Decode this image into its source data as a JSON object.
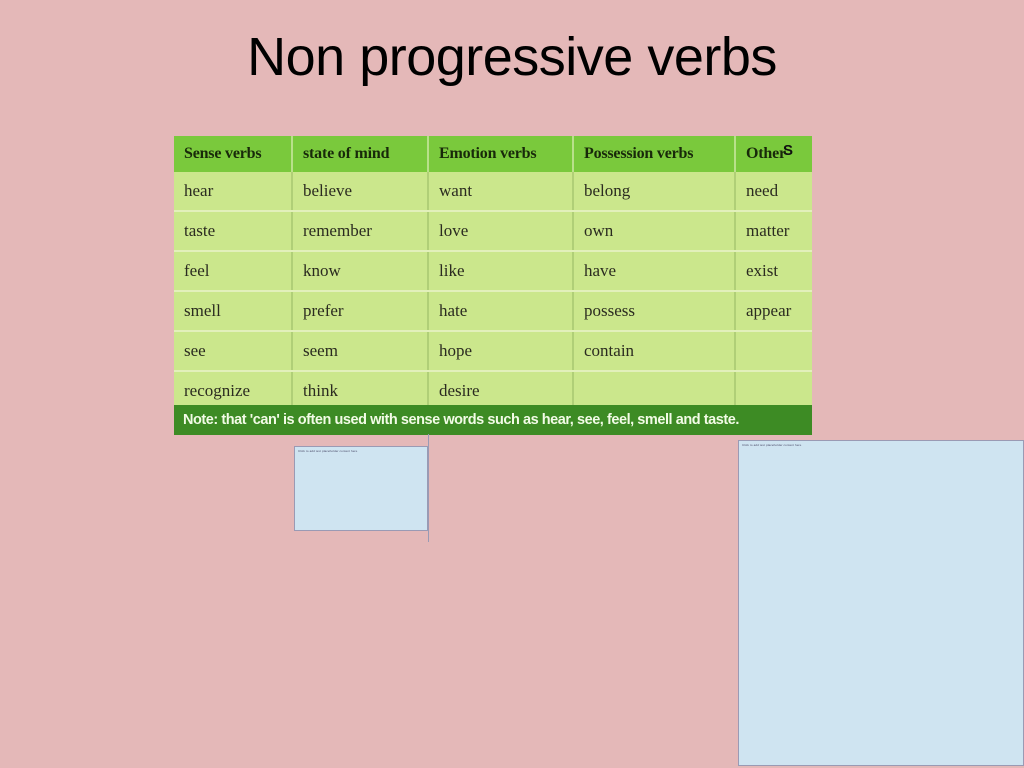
{
  "slide": {
    "title": "Non progressive verbs",
    "background_color": "#e4b8b8"
  },
  "table": {
    "header_color": "#7ac93c",
    "cell_color": "#cbe78c",
    "note_bar_color": "#3d8b24",
    "columns": [
      "Sense verbs",
      "state of mind",
      "Emotion verbs",
      "Possession verbs",
      "Other"
    ],
    "rows": [
      [
        "hear",
        "believe",
        "want",
        "belong",
        "need"
      ],
      [
        "taste",
        "remember",
        "love",
        "own",
        "matter"
      ],
      [
        "feel",
        "know",
        "like",
        "have",
        "exist"
      ],
      [
        "smell",
        "prefer",
        "hate",
        "possess",
        "appear"
      ],
      [
        "see",
        "seem",
        "hope",
        "contain",
        ""
      ],
      [
        "recognize",
        "think",
        "desire",
        "",
        ""
      ]
    ],
    "note": "Note: that 'can' is often used with sense words such as hear, see, feel, smell and taste."
  },
  "overlay": {
    "stray_letter": "S"
  },
  "placeholders": {
    "small": {
      "text": "Click to add text placeholder content here",
      "fill_color": "#cfe4f1"
    },
    "large": {
      "text": "Click to add text placeholder content here",
      "fill_color": "#cfe4f1"
    }
  }
}
